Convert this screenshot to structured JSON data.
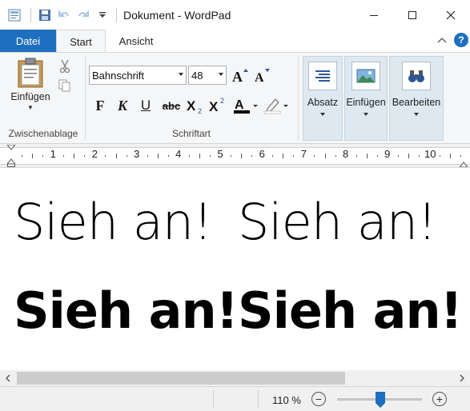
{
  "window": {
    "title": "Dokument - WordPad"
  },
  "ribbon": {
    "tabs": {
      "file": "Datei",
      "home": "Start",
      "view": "Ansicht",
      "help": "?"
    },
    "clipboard": {
      "paste_label": "Einfügen",
      "group_label": "Zwischenablage"
    },
    "font": {
      "family": "Bahnschrift",
      "size": "48",
      "group_label": "Schriftart",
      "bold": "F",
      "italic": "K",
      "underline": "U",
      "strike": "abc"
    },
    "paragraph": {
      "label": "Absatz"
    },
    "insert": {
      "label": "Einfügen"
    },
    "editing": {
      "label": "Bearbeiten"
    }
  },
  "ruler": {
    "numbers": [
      "1",
      "2",
      "3",
      "4",
      "5",
      "6",
      "7",
      "8",
      "9",
      "10"
    ]
  },
  "document": {
    "lines": [
      {
        "left": "Sieh an!",
        "right": "Sieh an!"
      },
      {
        "left": "Sieh an!",
        "right": "Sieh an!"
      }
    ]
  },
  "status": {
    "zoom": "110 %",
    "zoom_out": "−",
    "zoom_in": "+"
  },
  "colors": {
    "accent": "#1e6fbf",
    "font_color": "#000000",
    "highlight": "#ffffff"
  },
  "icons": {
    "app": "wordpad-icon",
    "save": "save-icon",
    "undo": "undo-icon",
    "redo": "redo-icon",
    "customize": "chevron-down-icon",
    "minimize": "minimize-icon",
    "maximize": "maximize-icon",
    "close": "close-icon",
    "cut": "scissors-icon",
    "copy": "copy-icon",
    "grow_font": "grow-font-icon",
    "shrink_font": "shrink-font-icon",
    "subscript": "subscript-icon",
    "superscript": "superscript-icon",
    "font_color": "font-color-icon",
    "highlight": "highlighter-icon"
  }
}
